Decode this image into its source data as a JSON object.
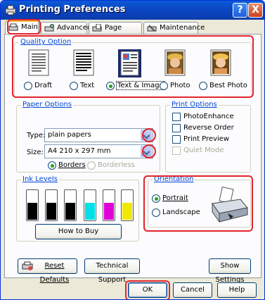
{
  "window": {
    "title": "Printing Preferences"
  },
  "titlebar": {
    "help_label": "?",
    "close_label": "X"
  },
  "tabs": [
    {
      "label": "Main",
      "icon": "printer-tab-icon",
      "active": true
    },
    {
      "label": "Advanced",
      "icon": "advanced-tab-icon",
      "active": false
    },
    {
      "label": "Page Layout",
      "icon": "page-layout-tab-icon",
      "active": false
    },
    {
      "label": "Maintenance",
      "icon": "maintenance-tab-icon",
      "active": false
    }
  ],
  "quality": {
    "label": "Quality Option",
    "options": [
      {
        "label": "Draft",
        "selected": false
      },
      {
        "label": "Text",
        "selected": false
      },
      {
        "label": "Text & Image",
        "selected": true
      },
      {
        "label": "Photo",
        "selected": false
      },
      {
        "label": "Best Photo",
        "selected": false
      }
    ]
  },
  "paper": {
    "label": "Paper Options",
    "type_label": "Type:",
    "type_value": "plain papers",
    "size_label": "Size:",
    "size_value": "A4 210 x 297 mm",
    "borders_label": "Borders",
    "borderless_label": "Borderless",
    "borders_selected": true
  },
  "print_options": {
    "label": "Print Options",
    "items": [
      {
        "label": "PhotoEnhance",
        "enabled": true,
        "checked": false
      },
      {
        "label": "Reverse Order",
        "enabled": true,
        "checked": false
      },
      {
        "label": "Print Preview",
        "enabled": true,
        "checked": false
      },
      {
        "label": "Quiet Mode",
        "enabled": false,
        "checked": false
      }
    ]
  },
  "ink": {
    "label": "Ink Levels",
    "cartridges": [
      {
        "color": "#000000",
        "level": 0.55
      },
      {
        "color": "#000000",
        "level": 0.55
      },
      {
        "color": "#000000",
        "level": 0.55
      },
      {
        "color": "#00e0e8",
        "level": 0.55
      },
      {
        "color": "#e000d8",
        "level": 0.55
      },
      {
        "color": "#f0e800",
        "level": 0.55
      }
    ],
    "how_to_buy_label": "How to Buy"
  },
  "orientation": {
    "label": "Orientation",
    "portrait_label": "Portrait",
    "landscape_label": "Landscape",
    "portrait_selected": true
  },
  "bottom_buttons": {
    "reset_label": "Reset Defaults",
    "support_label": "Technical Support",
    "show_settings_label": "Show Settings"
  },
  "dialog_buttons": {
    "ok_label": "OK",
    "cancel_label": "Cancel",
    "help_label": "Help"
  },
  "colors": {
    "highlight_red": "#e3242b",
    "group_label_blue": "#0046d5",
    "titlebar_blue": "#0a48c4"
  }
}
